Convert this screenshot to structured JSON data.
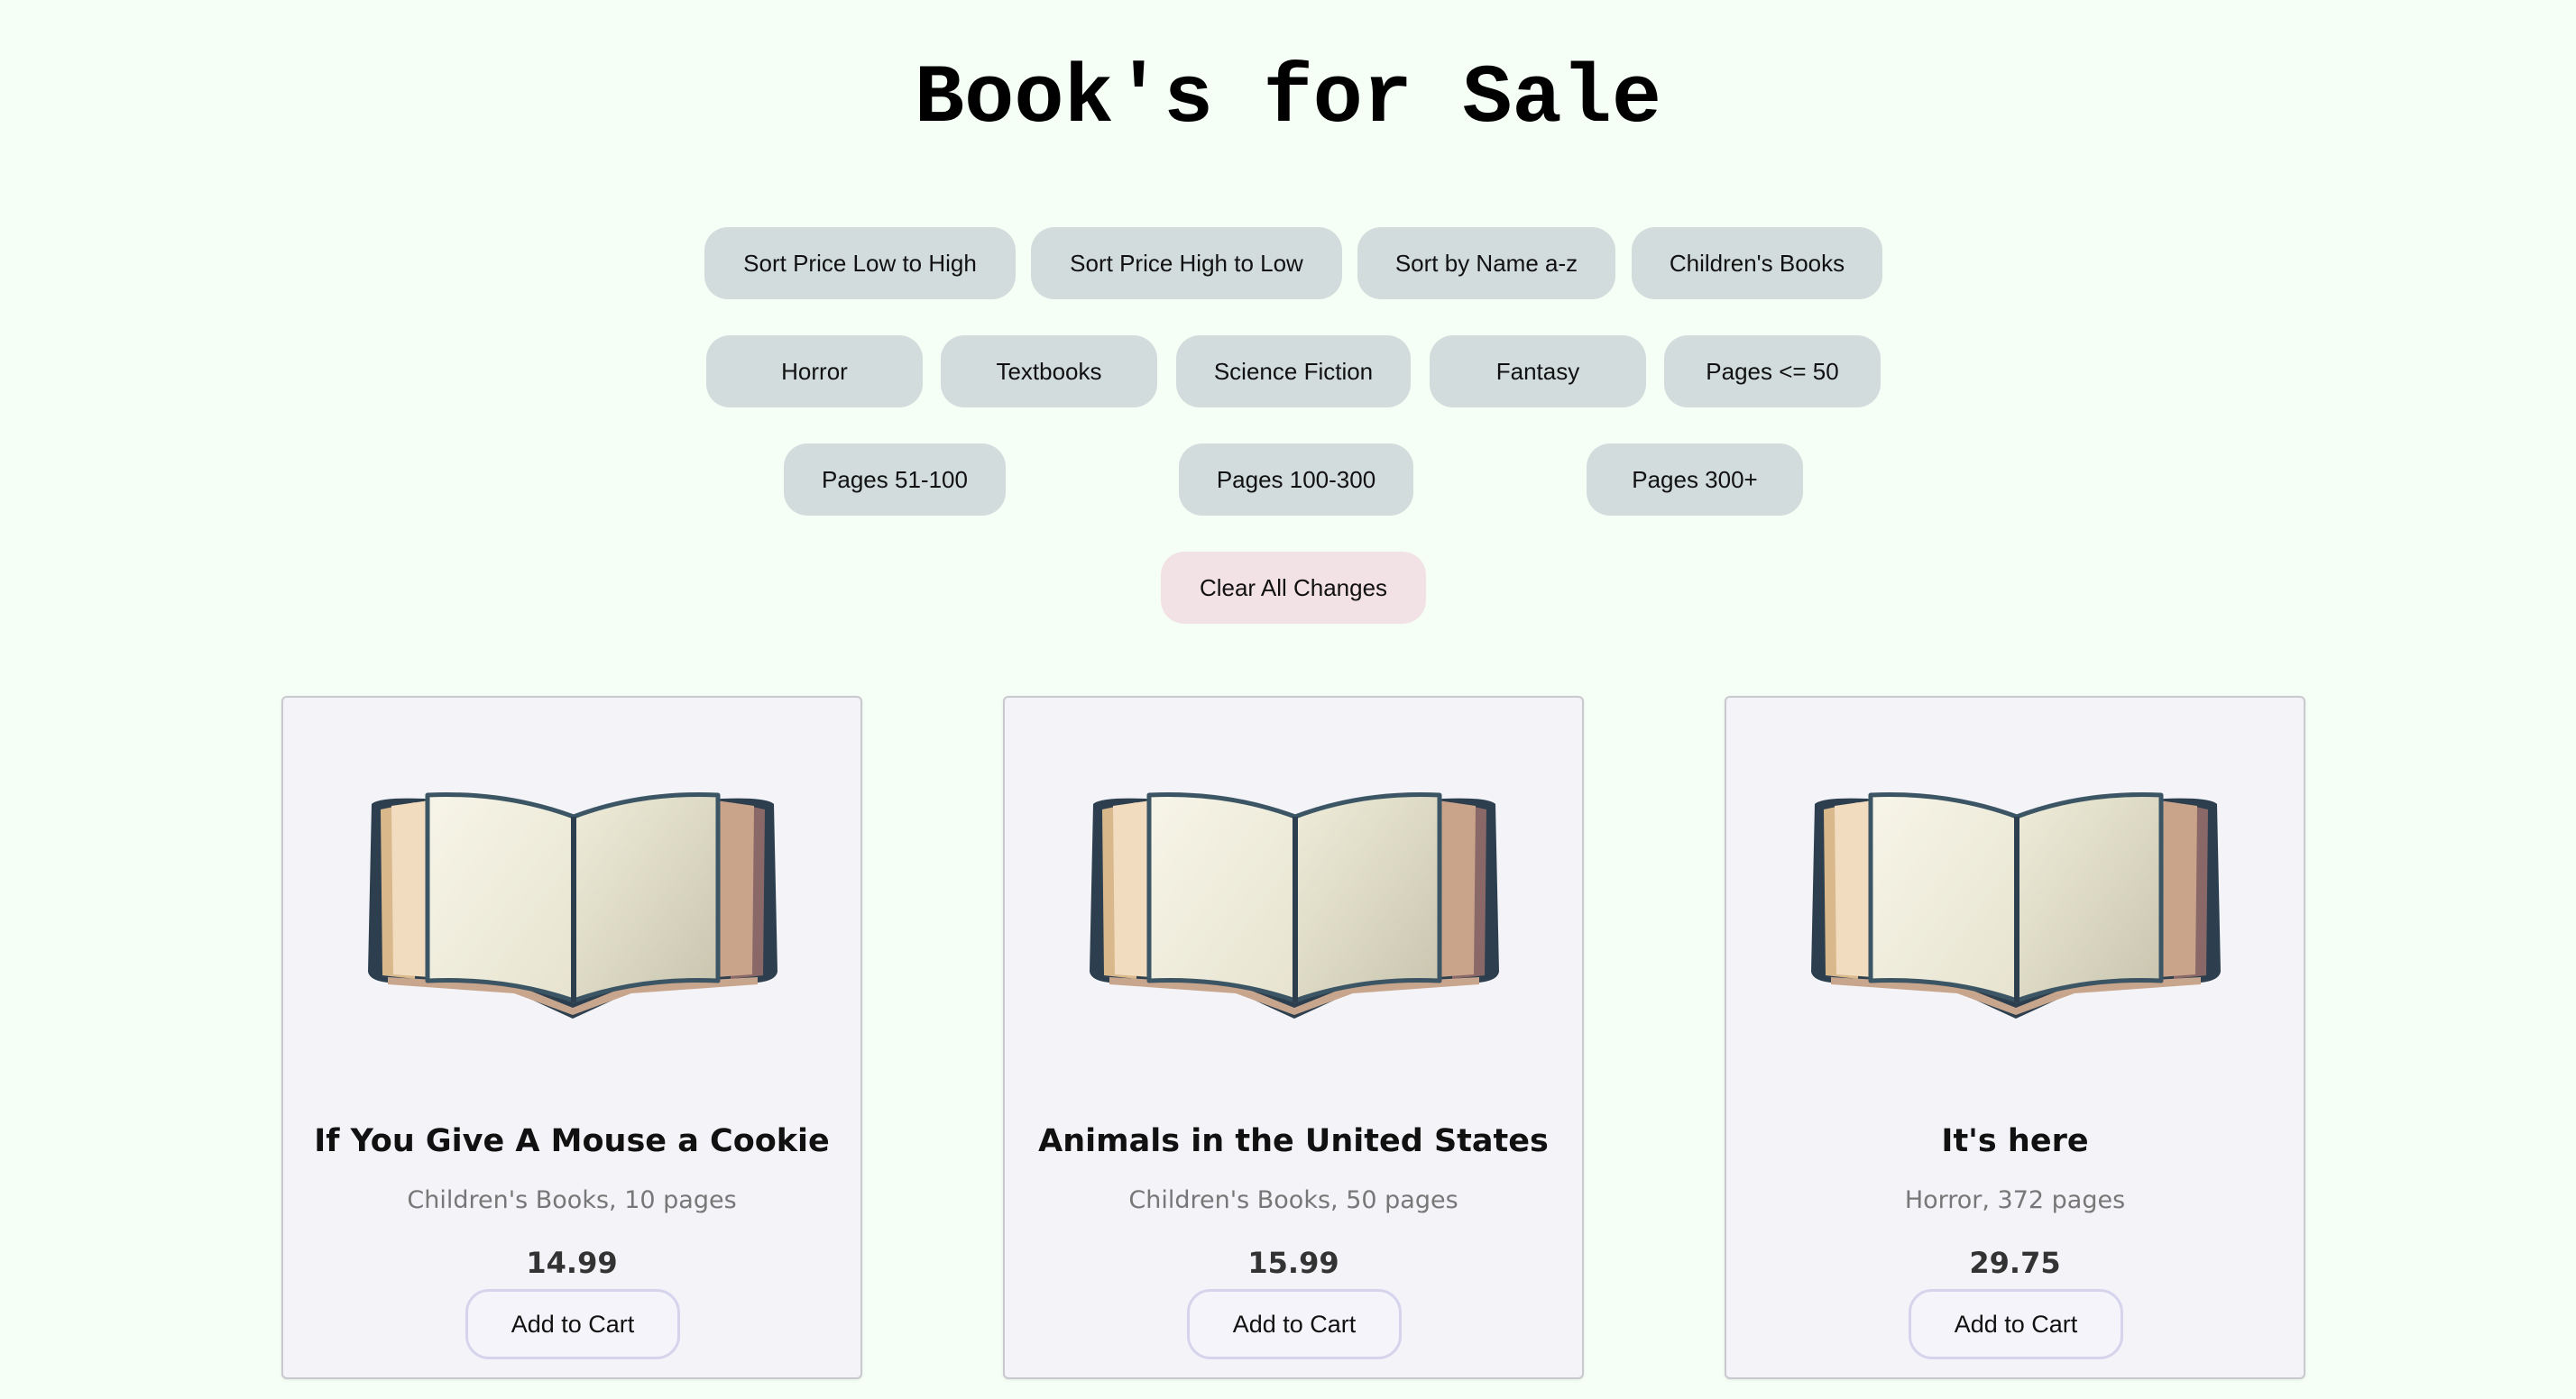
{
  "page": {
    "title": "Book's for Sale"
  },
  "filters": {
    "row1": [
      {
        "label": "Sort Price Low to High"
      },
      {
        "label": "Sort Price High to Low"
      },
      {
        "label": "Sort by Name a-z"
      },
      {
        "label": "Children's Books"
      }
    ],
    "row2": [
      {
        "label": "Horror"
      },
      {
        "label": "Textbooks"
      },
      {
        "label": "Science Fiction"
      },
      {
        "label": "Fantasy"
      },
      {
        "label": "Pages <= 50"
      }
    ],
    "row3": [
      {
        "label": "Pages 51-100"
      },
      {
        "label": "Pages 100-300"
      },
      {
        "label": "Pages 300+"
      }
    ],
    "clear_label": "Clear All Changes"
  },
  "books": [
    {
      "title": "If You Give A Mouse a Cookie",
      "meta": "Children's Books, 10 pages",
      "price": "14.99",
      "button": "Add to Cart",
      "image_icon": "open-book-icon"
    },
    {
      "title": "Animals in the United States",
      "meta": "Children's Books, 50 pages",
      "price": "15.99",
      "button": "Add to Cart",
      "image_icon": "open-book-icon"
    },
    {
      "title": "It's here",
      "meta": "Horror, 372 pages",
      "price": "29.75",
      "button": "Add to Cart",
      "image_icon": "open-book-icon"
    }
  ],
  "colors": {
    "background": "#f5fff5",
    "filter_button": "#d2dcdd",
    "clear_button": "#f2e2e6",
    "card_background": "#f3f3f8",
    "book_cover": "#2d3f4e"
  }
}
